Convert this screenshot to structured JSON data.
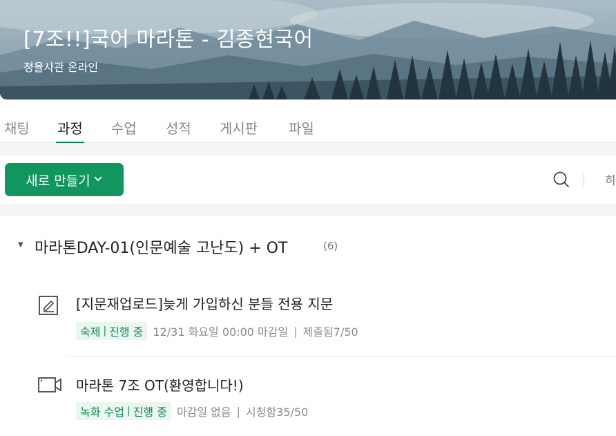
{
  "course": {
    "title": "[7조!!]국어 마라톤 - 김종현국어",
    "subtitle": "정율사관 온라인"
  },
  "tabs": [
    {
      "label": "채팅"
    },
    {
      "label": "과정"
    },
    {
      "label": "수업"
    },
    {
      "label": "성적"
    },
    {
      "label": "게시판"
    },
    {
      "label": "파일"
    }
  ],
  "active_tab": "과정",
  "toolbar": {
    "new_button_label": "새로 만들기",
    "more_label": "히"
  },
  "section": {
    "title": "마라톤DAY-01(인문예술 고난도) + OT",
    "count": "(6)"
  },
  "items": [
    {
      "title": "[지문재업로드]늦게 가입하신 분들 전용 지문",
      "badge_type": "숙제",
      "badge_status": "진행 중",
      "due": "12/31 화요일 00:00 마감일",
      "stat": "제출됨7/50",
      "icon": "assignment-edit-icon"
    },
    {
      "title": "마라톤 7조 OT(환영합니다!)",
      "badge_type": "녹화 수업",
      "badge_status": "진행 중",
      "due": "마감일 없음",
      "stat": "시청함35/50",
      "icon": "video-camera-icon"
    }
  ],
  "colors": {
    "accent": "#12965f",
    "badge_bg": "#eaf6ef",
    "badge_text": "#0e8a4f"
  }
}
